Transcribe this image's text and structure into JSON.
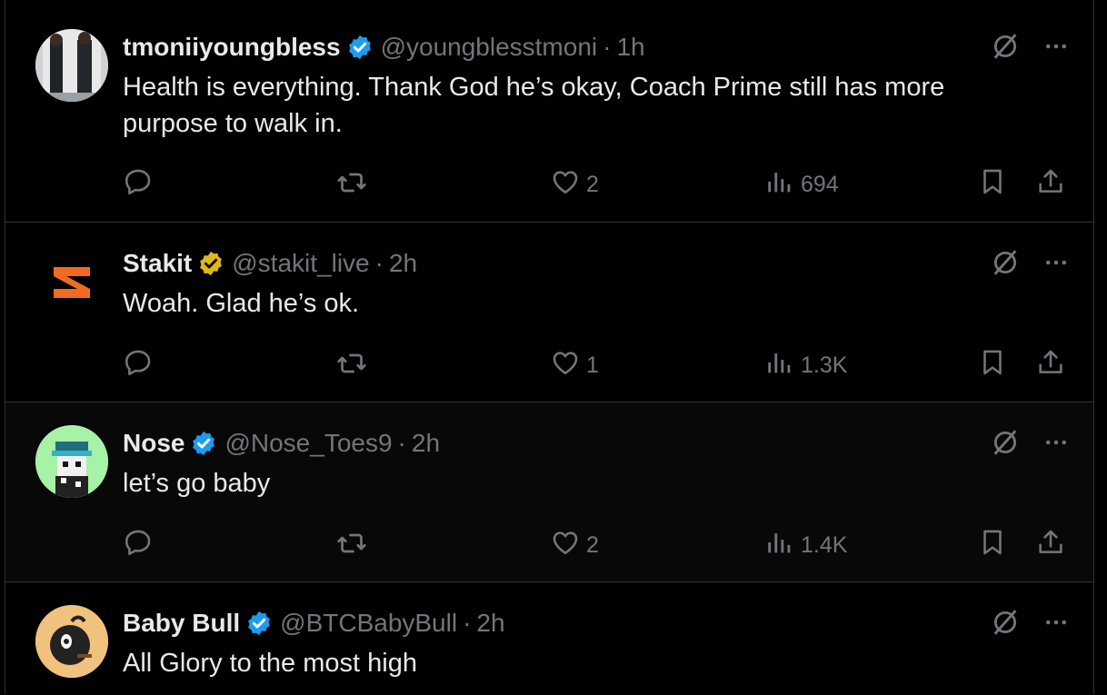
{
  "colors": {
    "background": "#000000",
    "text": "#e7e9ea",
    "secondary": "#71767b",
    "verified_blue": "#1d9bf0",
    "verified_gold": "#e2b719",
    "divider": "#2f3336"
  },
  "tweets": [
    {
      "display_name": "tmoniiyoungbless",
      "handle": "@youngblesstmoni",
      "dot": "·",
      "time": "1h",
      "badge": "blue-verified-icon",
      "text": "Health is everything. Thank God he’s okay, Coach Prime still has more purpose to walk in.",
      "replies": "",
      "reposts": "",
      "likes": "2",
      "views": "694"
    },
    {
      "display_name": "Stakit",
      "handle": "@stakit_live",
      "dot": "·",
      "time": "2h",
      "badge": "gold-verified-icon",
      "text": "Woah. Glad he’s ok.",
      "replies": "",
      "reposts": "",
      "likes": "1",
      "views": "1.3K"
    },
    {
      "display_name": "Nose",
      "handle": "@Nose_Toes9",
      "dot": "·",
      "time": "2h",
      "badge": "blue-verified-icon",
      "text": "let’s go baby",
      "replies": "",
      "reposts": "",
      "likes": "2",
      "views": "1.4K"
    },
    {
      "display_name": "Baby Bull",
      "handle": "@BTCBabyBull",
      "dot": "·",
      "time": "2h",
      "badge": "blue-verified-icon",
      "text": "All Glory to the most high"
    }
  ],
  "icons": [
    "reply-icon",
    "repost-icon",
    "like-icon",
    "views-icon",
    "bookmark-icon",
    "share-icon",
    "grok-icon",
    "more-icon"
  ]
}
